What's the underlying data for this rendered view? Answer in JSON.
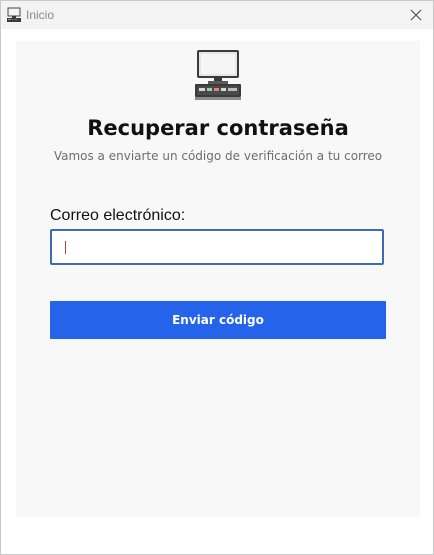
{
  "window": {
    "title": "Inicio",
    "app_icon": "computer-icon",
    "close_icon": "close-icon"
  },
  "hero": {
    "icon": "computer-icon"
  },
  "form": {
    "heading": "Recuperar contraseña",
    "subtitle": "Vamos a enviarte un código de verificación a tu correo",
    "email_label": "Correo electrónico:",
    "email_value": "",
    "submit_label": "Enviar código"
  },
  "colors": {
    "accent": "#2563eb",
    "input_border": "#3d6bba",
    "panel_bg": "#f8f8f8",
    "titlebar_bg": "#f3f3f3"
  }
}
